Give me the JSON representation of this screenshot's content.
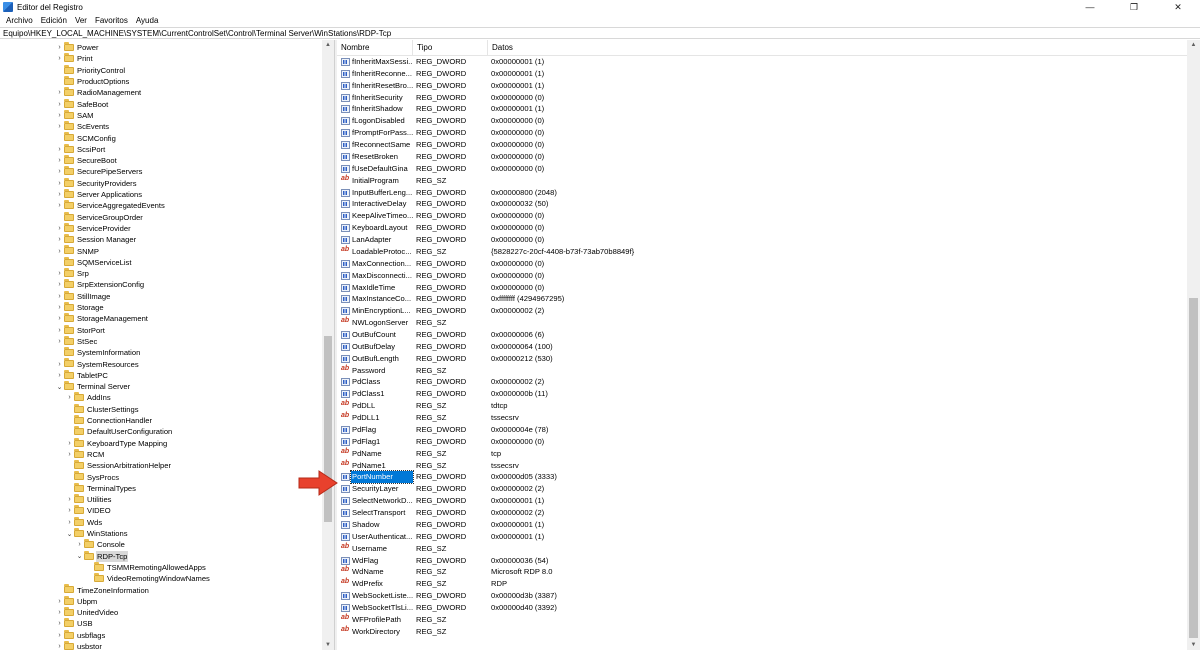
{
  "window": {
    "title": "Editor del Registro",
    "minimize": "—",
    "restore": "❐",
    "close": "✕"
  },
  "menu": [
    "Archivo",
    "Edición",
    "Ver",
    "Favoritos",
    "Ayuda"
  ],
  "address": "Equipo\\HKEY_LOCAL_MACHINE\\SYSTEM\\CurrentControlSet\\Control\\Terminal Server\\WinStations\\RDP-Tcp",
  "tree": [
    {
      "label": "Power",
      "level": 0,
      "expander": "collapsed"
    },
    {
      "label": "Print",
      "level": 0,
      "expander": "collapsed"
    },
    {
      "label": "PriorityControl",
      "level": 0,
      "expander": "none"
    },
    {
      "label": "ProductOptions",
      "level": 0,
      "expander": "none"
    },
    {
      "label": "RadioManagement",
      "level": 0,
      "expander": "collapsed"
    },
    {
      "label": "SafeBoot",
      "level": 0,
      "expander": "collapsed"
    },
    {
      "label": "SAM",
      "level": 0,
      "expander": "collapsed"
    },
    {
      "label": "ScEvents",
      "level": 0,
      "expander": "collapsed"
    },
    {
      "label": "SCMConfig",
      "level": 0,
      "expander": "none"
    },
    {
      "label": "ScsiPort",
      "level": 0,
      "expander": "collapsed"
    },
    {
      "label": "SecureBoot",
      "level": 0,
      "expander": "collapsed"
    },
    {
      "label": "SecurePipeServers",
      "level": 0,
      "expander": "collapsed"
    },
    {
      "label": "SecurityProviders",
      "level": 0,
      "expander": "collapsed"
    },
    {
      "label": "Server Applications",
      "level": 0,
      "expander": "collapsed"
    },
    {
      "label": "ServiceAggregatedEvents",
      "level": 0,
      "expander": "collapsed"
    },
    {
      "label": "ServiceGroupOrder",
      "level": 0,
      "expander": "none"
    },
    {
      "label": "ServiceProvider",
      "level": 0,
      "expander": "collapsed"
    },
    {
      "label": "Session Manager",
      "level": 0,
      "expander": "collapsed"
    },
    {
      "label": "SNMP",
      "level": 0,
      "expander": "collapsed"
    },
    {
      "label": "SQMServiceList",
      "level": 0,
      "expander": "none"
    },
    {
      "label": "Srp",
      "level": 0,
      "expander": "collapsed"
    },
    {
      "label": "SrpExtensionConfig",
      "level": 0,
      "expander": "collapsed"
    },
    {
      "label": "StillImage",
      "level": 0,
      "expander": "collapsed"
    },
    {
      "label": "Storage",
      "level": 0,
      "expander": "collapsed"
    },
    {
      "label": "StorageManagement",
      "level": 0,
      "expander": "collapsed"
    },
    {
      "label": "StorPort",
      "level": 0,
      "expander": "collapsed"
    },
    {
      "label": "StSec",
      "level": 0,
      "expander": "collapsed"
    },
    {
      "label": "SystemInformation",
      "level": 0,
      "expander": "none"
    },
    {
      "label": "SystemResources",
      "level": 0,
      "expander": "collapsed"
    },
    {
      "label": "TabletPC",
      "level": 0,
      "expander": "collapsed"
    },
    {
      "label": "Terminal Server",
      "level": 0,
      "expander": "expanded"
    },
    {
      "label": "AddIns",
      "level": 1,
      "expander": "collapsed"
    },
    {
      "label": "ClusterSettings",
      "level": 1,
      "expander": "none"
    },
    {
      "label": "ConnectionHandler",
      "level": 1,
      "expander": "none"
    },
    {
      "label": "DefaultUserConfiguration",
      "level": 1,
      "expander": "none"
    },
    {
      "label": "KeyboardType Mapping",
      "level": 1,
      "expander": "collapsed"
    },
    {
      "label": "RCM",
      "level": 1,
      "expander": "collapsed"
    },
    {
      "label": "SessionArbitrationHelper",
      "level": 1,
      "expander": "none"
    },
    {
      "label": "SysProcs",
      "level": 1,
      "expander": "none"
    },
    {
      "label": "TerminalTypes",
      "level": 1,
      "expander": "none"
    },
    {
      "label": "Utilities",
      "level": 1,
      "expander": "collapsed"
    },
    {
      "label": "VIDEO",
      "level": 1,
      "expander": "collapsed"
    },
    {
      "label": "Wds",
      "level": 1,
      "expander": "collapsed"
    },
    {
      "label": "WinStations",
      "level": 1,
      "expander": "expanded"
    },
    {
      "label": "Console",
      "level": 2,
      "expander": "collapsed"
    },
    {
      "label": "RDP-Tcp",
      "level": 2,
      "expander": "expanded",
      "selected": true
    },
    {
      "label": "TSMMRemotingAllowedApps",
      "level": 3,
      "expander": "none"
    },
    {
      "label": "VideoRemotingWindowNames",
      "level": 3,
      "expander": "none"
    },
    {
      "label": "TimeZoneInformation",
      "level": 0,
      "expander": "none"
    },
    {
      "label": "Ubpm",
      "level": 0,
      "expander": "collapsed"
    },
    {
      "label": "UnitedVideo",
      "level": 0,
      "expander": "collapsed"
    },
    {
      "label": "USB",
      "level": 0,
      "expander": "collapsed"
    },
    {
      "label": "usbflags",
      "level": 0,
      "expander": "collapsed"
    },
    {
      "label": "usbstor",
      "level": 0,
      "expander": "collapsed"
    }
  ],
  "columns": {
    "name": "Nombre",
    "type": "Tipo",
    "data": "Datos"
  },
  "values": [
    {
      "name": "fInheritMaxSessi...",
      "type": "REG_DWORD",
      "data": "0x00000001 (1)"
    },
    {
      "name": "fInheritReconne...",
      "type": "REG_DWORD",
      "data": "0x00000001 (1)"
    },
    {
      "name": "fInheritResetBro...",
      "type": "REG_DWORD",
      "data": "0x00000001 (1)"
    },
    {
      "name": "fInheritSecurity",
      "type": "REG_DWORD",
      "data": "0x00000000 (0)"
    },
    {
      "name": "fInheritShadow",
      "type": "REG_DWORD",
      "data": "0x00000001 (1)"
    },
    {
      "name": "fLogonDisabled",
      "type": "REG_DWORD",
      "data": "0x00000000 (0)"
    },
    {
      "name": "fPromptForPass...",
      "type": "REG_DWORD",
      "data": "0x00000000 (0)"
    },
    {
      "name": "fReconnectSame",
      "type": "REG_DWORD",
      "data": "0x00000000 (0)"
    },
    {
      "name": "fResetBroken",
      "type": "REG_DWORD",
      "data": "0x00000000 (0)"
    },
    {
      "name": "fUseDefaultGina",
      "type": "REG_DWORD",
      "data": "0x00000000 (0)"
    },
    {
      "name": "InitialProgram",
      "type": "REG_SZ",
      "data": ""
    },
    {
      "name": "InputBufferLeng...",
      "type": "REG_DWORD",
      "data": "0x00000800 (2048)"
    },
    {
      "name": "InteractiveDelay",
      "type": "REG_DWORD",
      "data": "0x00000032 (50)"
    },
    {
      "name": "KeepAliveTimeo...",
      "type": "REG_DWORD",
      "data": "0x00000000 (0)"
    },
    {
      "name": "KeyboardLayout",
      "type": "REG_DWORD",
      "data": "0x00000000 (0)"
    },
    {
      "name": "LanAdapter",
      "type": "REG_DWORD",
      "data": "0x00000000 (0)"
    },
    {
      "name": "LoadableProtoc...",
      "type": "REG_SZ",
      "data": "{5828227c-20cf-4408-b73f-73ab70b8849f}"
    },
    {
      "name": "MaxConnection...",
      "type": "REG_DWORD",
      "data": "0x00000000 (0)"
    },
    {
      "name": "MaxDisconnecti...",
      "type": "REG_DWORD",
      "data": "0x00000000 (0)"
    },
    {
      "name": "MaxIdleTime",
      "type": "REG_DWORD",
      "data": "0x00000000 (0)"
    },
    {
      "name": "MaxInstanceCo...",
      "type": "REG_DWORD",
      "data": "0xffffffff (4294967295)"
    },
    {
      "name": "MinEncryptionL...",
      "type": "REG_DWORD",
      "data": "0x00000002 (2)"
    },
    {
      "name": "NWLogonServer",
      "type": "REG_SZ",
      "data": ""
    },
    {
      "name": "OutBufCount",
      "type": "REG_DWORD",
      "data": "0x00000006 (6)"
    },
    {
      "name": "OutBufDelay",
      "type": "REG_DWORD",
      "data": "0x00000064 (100)"
    },
    {
      "name": "OutBufLength",
      "type": "REG_DWORD",
      "data": "0x00000212 (530)"
    },
    {
      "name": "Password",
      "type": "REG_SZ",
      "data": ""
    },
    {
      "name": "PdClass",
      "type": "REG_DWORD",
      "data": "0x00000002 (2)"
    },
    {
      "name": "PdClass1",
      "type": "REG_DWORD",
      "data": "0x0000000b (11)"
    },
    {
      "name": "PdDLL",
      "type": "REG_SZ",
      "data": "tdtcp"
    },
    {
      "name": "PdDLL1",
      "type": "REG_SZ",
      "data": "tssecsrv"
    },
    {
      "name": "PdFlag",
      "type": "REG_DWORD",
      "data": "0x0000004e (78)"
    },
    {
      "name": "PdFlag1",
      "type": "REG_DWORD",
      "data": "0x00000000 (0)"
    },
    {
      "name": "PdName",
      "type": "REG_SZ",
      "data": "tcp"
    },
    {
      "name": "PdName1",
      "type": "REG_SZ",
      "data": "tssecsrv"
    },
    {
      "name": "PortNumber",
      "type": "REG_DWORD",
      "data": "0x00000d05 (3333)",
      "selected": true
    },
    {
      "name": "SecurityLayer",
      "type": "REG_DWORD",
      "data": "0x00000002 (2)"
    },
    {
      "name": "SelectNetworkD...",
      "type": "REG_DWORD",
      "data": "0x00000001 (1)"
    },
    {
      "name": "SelectTransport",
      "type": "REG_DWORD",
      "data": "0x00000002 (2)"
    },
    {
      "name": "Shadow",
      "type": "REG_DWORD",
      "data": "0x00000001 (1)"
    },
    {
      "name": "UserAuthenticat...",
      "type": "REG_DWORD",
      "data": "0x00000001 (1)"
    },
    {
      "name": "Username",
      "type": "REG_SZ",
      "data": ""
    },
    {
      "name": "WdFlag",
      "type": "REG_DWORD",
      "data": "0x00000036 (54)"
    },
    {
      "name": "WdName",
      "type": "REG_SZ",
      "data": "Microsoft RDP 8.0"
    },
    {
      "name": "WdPrefix",
      "type": "REG_SZ",
      "data": "RDP"
    },
    {
      "name": "WebSocketListe...",
      "type": "REG_DWORD",
      "data": "0x00000d3b (3387)"
    },
    {
      "name": "WebSocketTlsLi...",
      "type": "REG_DWORD",
      "data": "0x00000d40 (3392)"
    },
    {
      "name": "WFProfilePath",
      "type": "REG_SZ",
      "data": ""
    },
    {
      "name": "WorkDirectory",
      "type": "REG_SZ",
      "data": ""
    }
  ],
  "colors": {
    "selection": "#0078d7",
    "arrow": "#e8412d",
    "folder": "#f3cf67"
  },
  "icons": {
    "app": "registry-app-icon",
    "folder": "folder-icon",
    "dword": "binary-value-icon",
    "string": "string-value-icon",
    "pointer": "red-arrow-icon"
  }
}
